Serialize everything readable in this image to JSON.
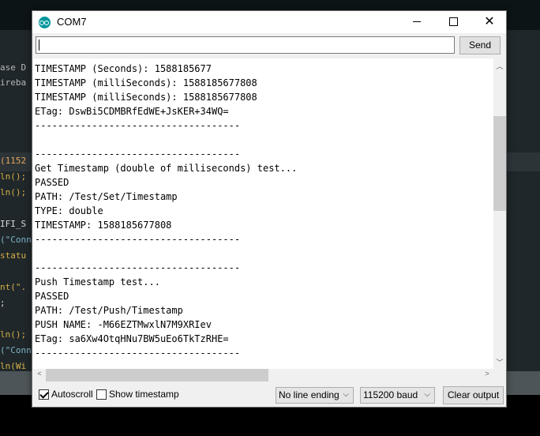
{
  "window": {
    "title": "COM7"
  },
  "send_bar": {
    "input_value": "",
    "send_label": "Send"
  },
  "output_lines": [
    "TIMESTAMP (Seconds): 1588185677",
    "TIMESTAMP (milliSeconds): 1588185677808",
    "TIMESTAMP (milliSeconds): 1588185677808",
    "ETag: DswBi5CDMBRfEdWE+JsKER+34WQ=",
    "------------------------------------",
    "",
    "------------------------------------",
    "Get Timestamp (double of milliseconds) test...",
    "PASSED",
    "PATH: /Test/Set/Timestamp",
    "TYPE: double",
    "TIMESTAMP: 1588185677808",
    "------------------------------------",
    "",
    "------------------------------------",
    "Push Timestamp test...",
    "PASSED",
    "PATH: /Test/Push/Timestamp",
    "PUSH NAME: -M66EZTMwxlN7M9XRIev",
    "ETag: sa6Xw4OtqHNu7BW5uEo6TkTzRHE=",
    "------------------------------------"
  ],
  "bottom_bar": {
    "autoscroll_label": "Autoscroll",
    "autoscroll_checked": true,
    "timestamp_label": "Show timestamp",
    "timestamp_checked": false,
    "line_ending": "No line ending",
    "baud_rate": "115200 baud",
    "clear_label": "Clear output"
  },
  "background_code": [
    {
      "text": "ase D",
      "color": "#b7b7b7"
    },
    {
      "text": "ireba",
      "color": "#b7b7b7"
    },
    {
      "text": "(1152",
      "color": "#e5a65b"
    },
    {
      "text": "ln();",
      "color": "#d6b047"
    },
    {
      "text": "ln();",
      "color": "#d6b047"
    },
    {
      "text": "IFI_S",
      "color": "#d8d8d8"
    },
    {
      "text": "(\"Conn",
      "color": "#7fb3c6"
    },
    {
      "text": "statu",
      "color": "#d6b047"
    },
    {
      "text": "nt(\".",
      "color": "#d6b047"
    },
    {
      "text": ";",
      "color": "#d8d8d8"
    },
    {
      "text": "ln();",
      "color": "#d6b047"
    },
    {
      "text": "(\"Conn",
      "color": "#7fb3c6"
    },
    {
      "text": "ln(Wi",
      "color": "#d6b047"
    }
  ],
  "colors": {
    "accent": "#00979c",
    "editor_bg": "#1f272a"
  }
}
